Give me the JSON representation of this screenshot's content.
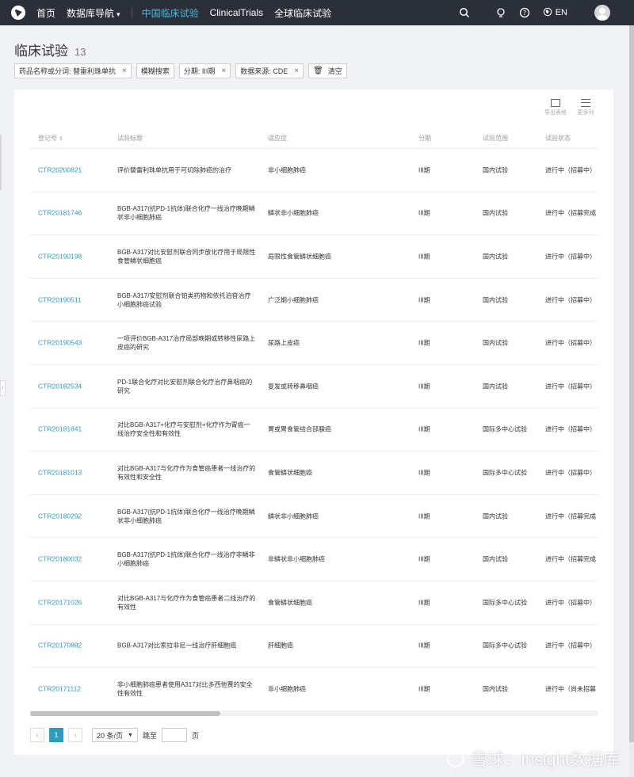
{
  "nav": {
    "items": [
      {
        "label": "首页",
        "active": false
      },
      {
        "label": "数据库导航",
        "active": false,
        "dropdown": true
      },
      {
        "label": "中国临床试验",
        "active": true
      },
      {
        "label": "ClinicalTrials",
        "active": false
      },
      {
        "label": "全球临床试验",
        "active": false
      }
    ],
    "lang": "EN",
    "caret": "▾"
  },
  "header": {
    "title": "临床试验",
    "count": "13"
  },
  "filters": [
    {
      "label": "药品名称或分词: 替雷利珠单抗"
    },
    {
      "label": "模糊搜索"
    },
    {
      "label": "分期: III期"
    },
    {
      "label": "数据来源: CDE"
    }
  ],
  "clear_label": "清空",
  "tools": {
    "export": "导出表格",
    "more": "更多列"
  },
  "table": {
    "headers": [
      "登记号",
      "试验标题",
      "适应症",
      "分期",
      "试验范围",
      "试验状态"
    ],
    "rows": [
      {
        "id": "CTR20200821",
        "title": "评价替雷利珠单抗用于可切除肺癌的治疗",
        "indication": "非小细胞肺癌",
        "phase": "III期",
        "scope": "国内试验",
        "status": "进行中（招募中）"
      },
      {
        "id": "CTR20181746",
        "title": "BGB-A317(抗PD-1抗体)联合化疗一线治疗晚期鳞状非小细胞肺癌",
        "indication": "鳞状非小细胞肺癌",
        "phase": "III期",
        "scope": "国内试验",
        "status": "进行中（招募完成"
      },
      {
        "id": "CTR20190198",
        "title": "BGB-A317对比安慰剂联合同步放化疗用于局限性食管鳞状细胞癌",
        "indication": "局限性食管鳞状细胞癌",
        "phase": "III期",
        "scope": "国内试验",
        "status": "进行中（招募中）"
      },
      {
        "id": "CTR20190511",
        "title": "BGB-A317/安慰剂联合铂类药物和依托泊苷治疗小细胞肺癌试验",
        "indication": "广泛期小细胞肺癌",
        "phase": "III期",
        "scope": "国内试验",
        "status": "进行中（招募中）"
      },
      {
        "id": "CTR20190543",
        "title": "一项评价BGB-A317治疗局部晚期或转移性尿路上皮癌的研究",
        "indication": "尿路上皮癌",
        "phase": "III期",
        "scope": "国内试验",
        "status": "进行中（招募中）"
      },
      {
        "id": "CTR20182534",
        "title": "PD-1联合化疗对比安慰剂联合化疗治疗鼻咽癌的研究",
        "indication": "复发或转移鼻咽癌",
        "phase": "III期",
        "scope": "国内试验",
        "status": "进行中（招募中）"
      },
      {
        "id": "CTR20181841",
        "title": "对比BGB-A317+化疗与安慰剂+化疗作为胃癌一线治疗安全性和有效性",
        "indication": "胃或胃食管结合部腺癌",
        "phase": "III期",
        "scope": "国际多中心试验",
        "status": "进行中（招募中）"
      },
      {
        "id": "CTR20181013",
        "title": "对比BGB-A317与化疗作为食管癌患者一线治疗的有效性和安全性",
        "indication": "食管鳞状细胞癌",
        "phase": "III期",
        "scope": "国际多中心试验",
        "status": "进行中（招募中）"
      },
      {
        "id": "CTR20180292",
        "title": "BGB-A317(抗PD-1抗体)联合化疗一线治疗晚期鳞状非小细胞肺癌",
        "indication": "鳞状非小细胞肺癌",
        "phase": "III期",
        "scope": "国内试验",
        "status": "进行中（招募完成"
      },
      {
        "id": "CTR20180032",
        "title": "BGB-A317(抗PD-1抗体)联合化疗一线治疗非鳞非小细胞肺癌",
        "indication": "非鳞状非小细胞肺癌",
        "phase": "III期",
        "scope": "国内试验",
        "status": "进行中（招募完成"
      },
      {
        "id": "CTR20171026",
        "title": "对比BGB-A317与化疗作为食管癌患者二线治疗的有效性",
        "indication": "食管鳞状细胞癌",
        "phase": "III期",
        "scope": "国际多中心试验",
        "status": "进行中（招募中）"
      },
      {
        "id": "CTR20170882",
        "title": "BGB-A317对比索拉非尼一线治疗肝细胞癌",
        "indication": "肝细胞癌",
        "phase": "III期",
        "scope": "国际多中心试验",
        "status": "进行中（招募中）"
      },
      {
        "id": "CTR20171112",
        "title": "非小细胞肺癌患者使用A317对比多西他赛的安全性有效性",
        "indication": "非小细胞肺癌",
        "phase": "III期",
        "scope": "国内试验",
        "status": "进行中（尚未招募"
      }
    ]
  },
  "pager": {
    "current": "1",
    "page_size": "20 条/页",
    "jump_label": "跳至",
    "page_label": "页"
  },
  "watermark": "雪球：Insight数据库",
  "colors": {
    "nav_bg": "#2b2f3a",
    "accent": "#2e9bc0",
    "active_nav": "#4db8d8"
  }
}
